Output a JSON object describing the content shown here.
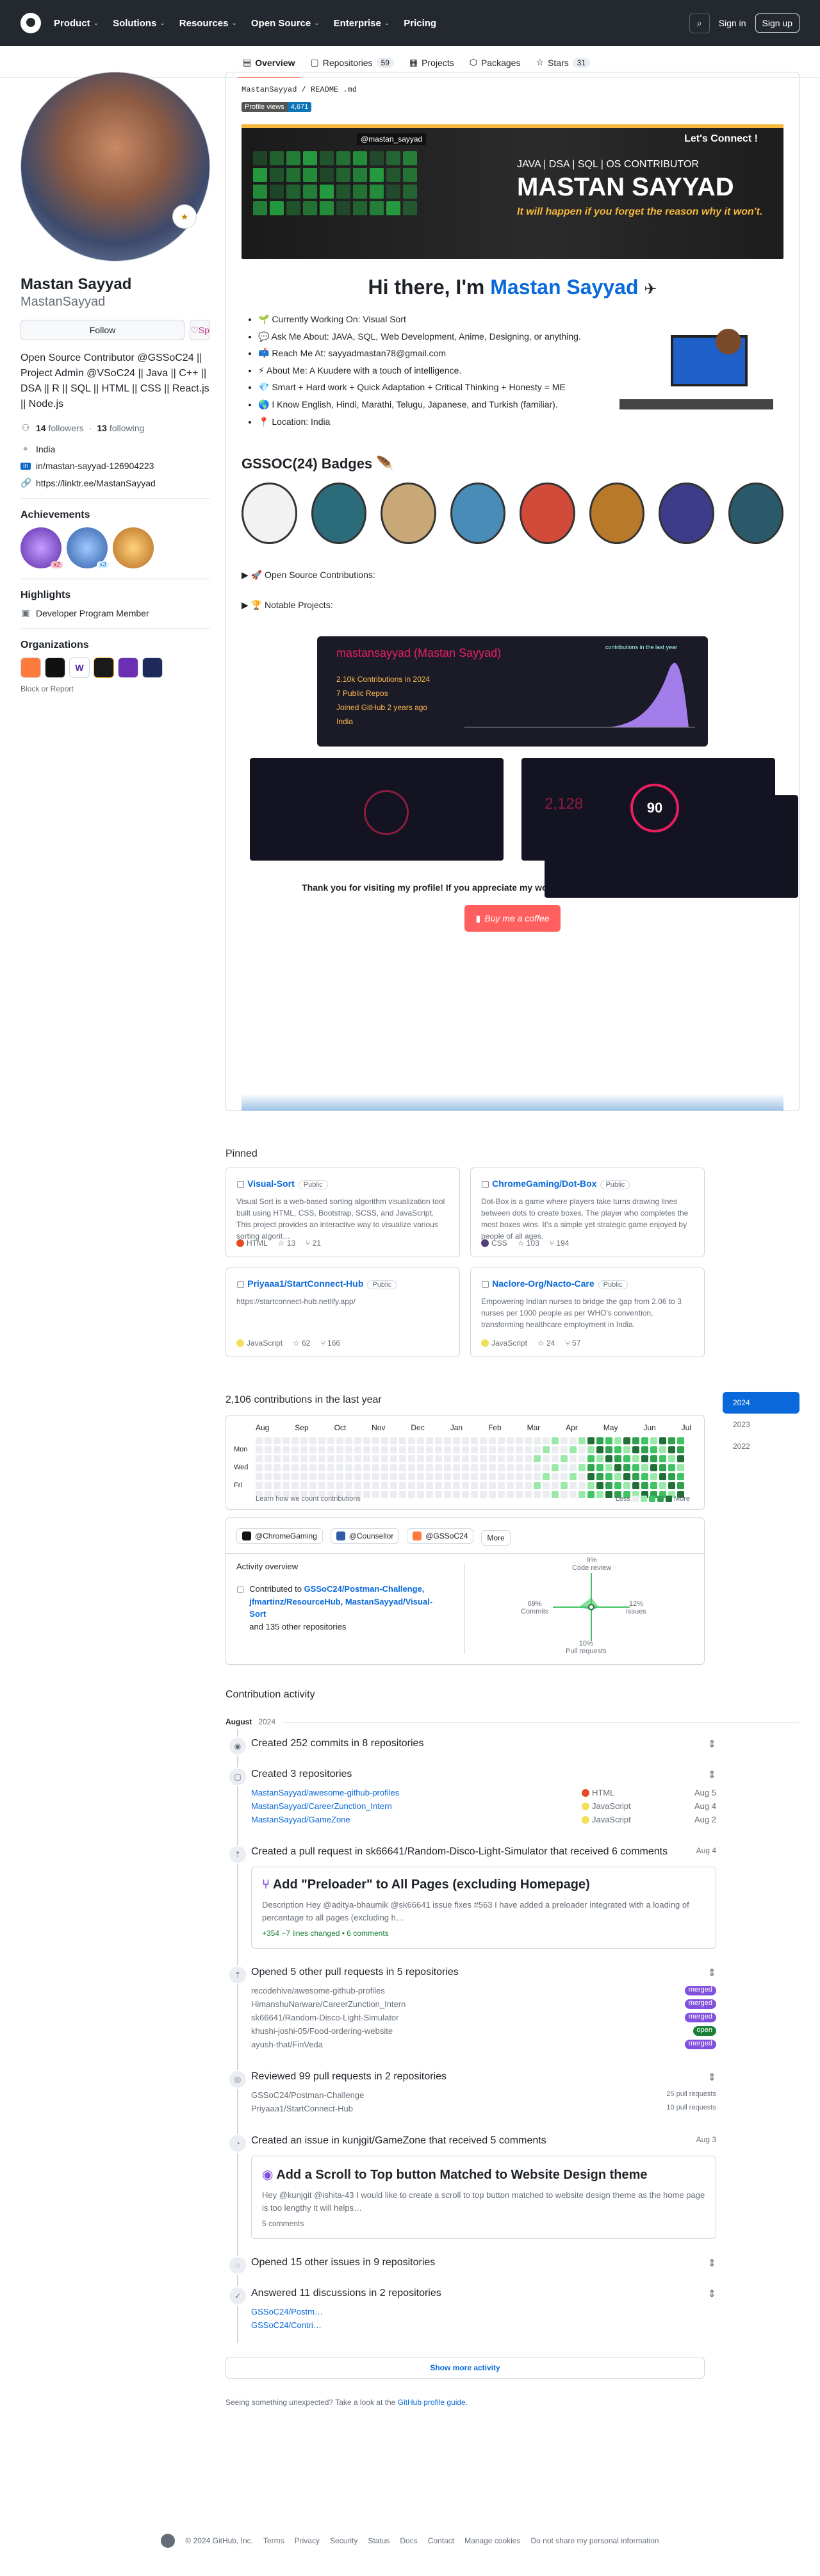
{
  "nav": {
    "items": [
      "Product",
      "Solutions",
      "Resources",
      "Open Source",
      "Enterprise",
      "Pricing"
    ],
    "signin": "Sign in",
    "signup": "Sign up"
  },
  "tabs": [
    {
      "label": "Overview"
    },
    {
      "label": "Repositories",
      "count": "59"
    },
    {
      "label": "Projects"
    },
    {
      "label": "Packages"
    },
    {
      "label": "Stars",
      "count": "31"
    }
  ],
  "profile": {
    "name": "Mastan Sayyad",
    "login": "MastanSayyad",
    "follow": "Follow",
    "sponsor": "Sp",
    "bio": "Open Source Contributor @GSSoC24 || Project Admin @VSoC24 || Java || C++ || DSA || R || SQL || HTML || CSS || React.js || Node.js",
    "followers": "14",
    "followers_label": "followers",
    "following": "13",
    "following_label": "following",
    "location": "India",
    "linkedin": "in/mastan-sayyad-126904223",
    "link": "https://linktr.ee/MastanSayyad",
    "achievements_title": "Achievements",
    "ach_badge1": "x2",
    "ach_badge2": "x3",
    "highlights_title": "Highlights",
    "highlight": "Developer Program Member",
    "orgs_title": "Organizations",
    "block": "Block or Report"
  },
  "readme": {
    "path": "MastanSayyad / README .md",
    "views_label": "Profile views",
    "views": "4,671",
    "banner_sub": "JAVA | DSA | SQL | OS CONTRIBUTOR",
    "banner_name": "MASTAN SAYYAD",
    "banner_tag": "It will happen if you forget the reason why it won't.",
    "banner_connect": "Let's Connect !",
    "banner_handle": "@mastan_sayyad",
    "hi": "Hi there, I'm ",
    "hi_name": "Mastan Sayyad",
    "facts": [
      "🌱 Currently Working On: Visual Sort",
      "💬 Ask Me About: JAVA, SQL, Web Development, Anime, Designing, or anything.",
      "📫 Reach Me At: sayyadmastan78@gmail.com",
      "⚡ About Me: A Kuudere with a touch of intelligence.",
      "💎 Smart + Hard work + Quick Adaptation + Critical Thinking + Honesty = ME",
      "🌎 I Know English, Hindi, Marathi, Telugu, Japanese, and Turkish (familiar).",
      "📍 Location: India"
    ],
    "badges_title": "GSSOC(24) Badges 🪶",
    "details1": "▶ 🚀 Open Source Contributions:",
    "details2": "▶ 🏆 Notable Projects:",
    "stats_name": "mastansayyad (Mastan Sayyad)",
    "stats_lines": [
      "2.10k Contributions in 2024",
      "7 Public Repos",
      "Joined GitHub 2 years ago",
      "India"
    ],
    "stats_chart_label": "contributions in the last year",
    "streak_num": "2,128",
    "streak_center": "90",
    "thanks": "Thank you for visiting my profile! If you appreciate my work, consider buying me a coffee or tea. 😊",
    "coffee": "Buy me a coffee"
  },
  "pinned": {
    "title": "Pinned",
    "items": [
      {
        "name": "Visual-Sort",
        "vis": "Public",
        "desc": "Visual Sort is a web-based sorting algorithm visualization tool built using HTML, CSS, Bootstrap, SCSS, and JavaScript. This project provides an interactive way to visualize various sorting algorit…",
        "lang": "HTML",
        "color": "#e34c26",
        "stars": "13",
        "forks": "21"
      },
      {
        "name": "ChromeGaming/Dot-Box",
        "vis": "Public",
        "desc": "Dot-Box is a game where players take turns drawing lines between dots to create boxes. The player who completes the most boxes wins. It's a simple yet strategic game enjoyed by people of all ages.",
        "lang": "CSS",
        "color": "#563d7c",
        "stars": "103",
        "forks": "194"
      },
      {
        "name": "Priyaaa1/StartConnect-Hub",
        "vis": "Public",
        "desc": "https://startconnect-hub.netlify.app/",
        "lang": "JavaScript",
        "color": "#f1e05a",
        "stars": "62",
        "forks": "166"
      },
      {
        "name": "Naclore-Org/Nacto-Care",
        "vis": "Public",
        "desc": "Empowering Indian nurses to bridge the gap from 2.06 to 3 nurses per 1000 people as per WHO's convention, transforming healthcare employment in India.",
        "lang": "JavaScript",
        "color": "#f1e05a",
        "stars": "24",
        "forks": "57"
      }
    ]
  },
  "calendar": {
    "title": "2,106 contributions in the last year",
    "months": [
      "Aug",
      "Sep",
      "Oct",
      "Nov",
      "Dec",
      "Jan",
      "Feb",
      "Mar",
      "Apr",
      "May",
      "Jun",
      "Jul"
    ],
    "days": [
      "Mon",
      "Wed",
      "Fri"
    ],
    "learn": "Learn how we count contributions",
    "less": "Less",
    "more": "More",
    "years": [
      "2024",
      "2023",
      "2022"
    ]
  },
  "overview": {
    "orgs": [
      "@ChromeGaming",
      "@Counsellor",
      "@GSSoC24",
      "More"
    ],
    "title": "Activity overview",
    "contrib_prefix": "Contributed to ",
    "contrib_repos": "GSSoC24/Postman-Challenge, jfmartinz/ResourceHub, MastanSayyad/Visual-Sort",
    "contrib_more": "and 135 other repositories",
    "cr": "9%",
    "cr_label": "Code review",
    "commits": "69%",
    "commits_label": "Commits",
    "issues": "12%",
    "issues_label": "Issues",
    "prs": "10%",
    "prs_label": "Pull requests"
  },
  "activity": {
    "title": "Contribution activity",
    "month": "August",
    "year": "2024",
    "commits": "Created 252 commits in 8 repositories",
    "repos_title": "Created 3 repositories",
    "repos": [
      {
        "name": "MastanSayyad/awesome-github-profiles",
        "lang": "HTML",
        "color": "#e34c26",
        "date": "Aug 5"
      },
      {
        "name": "MastanSayyad/CareerZunction_Intern",
        "lang": "JavaScript",
        "color": "#f1e05a",
        "date": "Aug 4"
      },
      {
        "name": "MastanSayyad/GameZone",
        "lang": "JavaScript",
        "color": "#f1e05a",
        "date": "Aug 2"
      }
    ],
    "pr_title": "Created a pull request in sk66641/Random-Disco-Light-Simulator that received 6 comments",
    "pr_date": "Aug 4",
    "pr_box_title": "Add \"Preloader\" to All Pages (excluding Homepage)",
    "pr_box_desc": "Description Hey @aditya-bhaumik @sk66641 issue fixes #563 I have added a preloader integrated with a loading of percentage to all pages (excluding h…",
    "pr_box_lines": "+354 −7 lines changed • 6 comments",
    "opened_prs": "Opened 5 other pull requests in 5 repositories",
    "pr_rows": [
      {
        "repo": "recodehive/awesome-github-profiles",
        "state": "merged"
      },
      {
        "repo": "HimanshuNarware/CareerZunction_Intern",
        "state": "merged"
      },
      {
        "repo": "sk66641/Random-Disco-Light-Simulator",
        "state": "merged"
      },
      {
        "repo": "khushi-joshi-05/Food-ordering-website",
        "state": "open"
      },
      {
        "repo": "ayush-that/FinVeda",
        "state": "merged"
      }
    ],
    "reviewed": "Reviewed 99 pull requests in 2 repositories",
    "rev_rows": [
      {
        "repo": "GSSoC24/Postman-Challenge",
        "n": "25 pull requests"
      },
      {
        "repo": "Priyaaa1/StartConnect-Hub",
        "n": "10 pull requests"
      }
    ],
    "issue_title": "Created an issue in kunjgit/GameZone that received 5 comments",
    "issue_date": "Aug 3",
    "issue_box_title": "Add a Scroll to Top button Matched to Website Design theme",
    "issue_box_desc": "Hey @kunjgit @ishita-43 I would like to create a scroll to top button matched to website design theme as the home page is too lengthy it will helps…",
    "issue_box_comments": "5 comments",
    "opened_issues": "Opened 15 other issues in 9 repositories",
    "answered": "Answered 11 discussions in 2 repositories",
    "ans_rows": [
      "GSSoC24/Postm…",
      "GSSoC24/Contri…"
    ],
    "more": "Show more activity",
    "feedback": "Seeing something unexpected? Take a look at the ",
    "feedback_link": "GitHub profile guide",
    "feedback_end": "."
  },
  "footer": [
    "© 2024 GitHub, Inc.",
    "Terms",
    "Privacy",
    "Security",
    "Status",
    "Docs",
    "Contact",
    "Manage cookies",
    "Do not share my personal information"
  ]
}
